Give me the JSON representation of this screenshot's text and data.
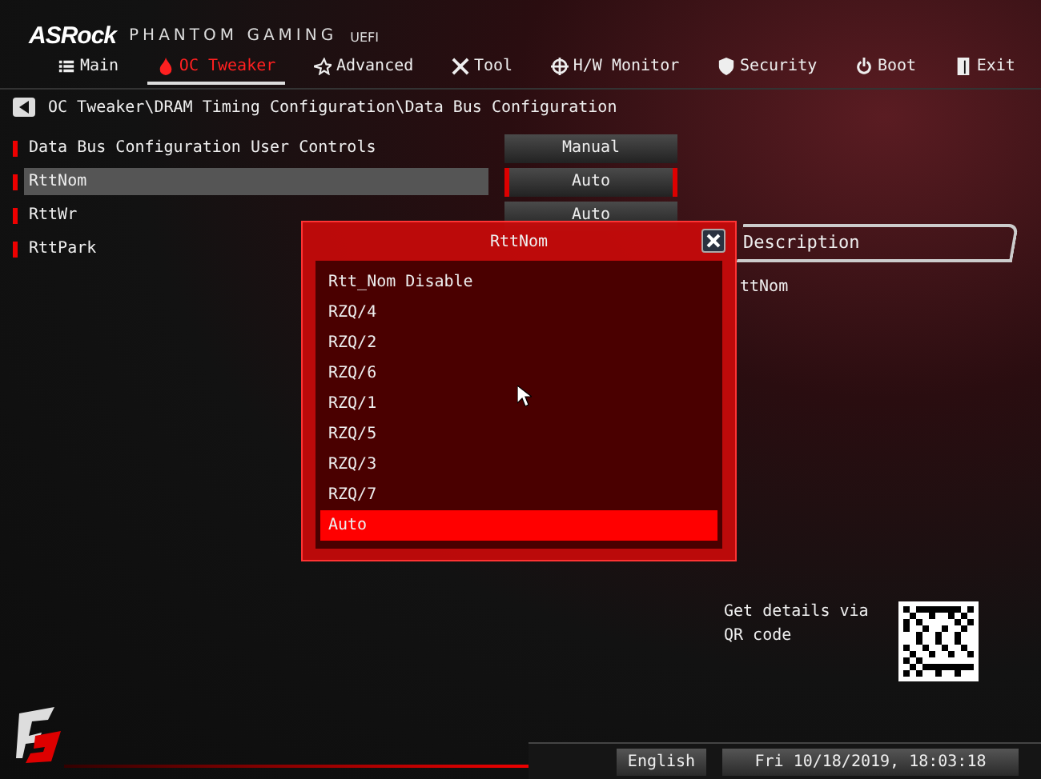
{
  "brand": {
    "logo": "ASRock",
    "subtitle": "PHANTOM GAMING",
    "suffix": "UEFI"
  },
  "tabs": [
    {
      "label": "Main",
      "selected": false
    },
    {
      "label": "OC Tweaker",
      "selected": true
    },
    {
      "label": "Advanced",
      "selected": false
    },
    {
      "label": "Tool",
      "selected": false
    },
    {
      "label": "H/W Monitor",
      "selected": false
    },
    {
      "label": "Security",
      "selected": false
    },
    {
      "label": "Boot",
      "selected": false
    },
    {
      "label": "Exit",
      "selected": false
    }
  ],
  "breadcrumb": "OC Tweaker\\DRAM Timing Configuration\\Data Bus Configuration",
  "settings": [
    {
      "label": "Data Bus Configuration User Controls",
      "value": "Manual",
      "selected": false
    },
    {
      "label": "RttNom",
      "value": "Auto",
      "selected": true
    },
    {
      "label": "RttWr",
      "value": "Auto",
      "selected": false
    },
    {
      "label": "RttPark",
      "selected": false
    }
  ],
  "description": {
    "title": "Description",
    "text": "ttNom"
  },
  "popup": {
    "title": "RttNom",
    "options": [
      {
        "label": "Rtt_Nom Disable",
        "selected": false
      },
      {
        "label": "RZQ/4",
        "selected": false
      },
      {
        "label": "RZQ/2",
        "selected": false
      },
      {
        "label": "RZQ/6",
        "selected": false
      },
      {
        "label": "RZQ/1",
        "selected": false
      },
      {
        "label": "RZQ/5",
        "selected": false
      },
      {
        "label": "RZQ/3",
        "selected": false
      },
      {
        "label": "RZQ/7",
        "selected": false
      },
      {
        "label": "Auto",
        "selected": true
      }
    ]
  },
  "qr": {
    "text": "Get details via QR code"
  },
  "status": {
    "language": "English",
    "datetime": "Fri 10/18/2019, 18:03:18"
  }
}
